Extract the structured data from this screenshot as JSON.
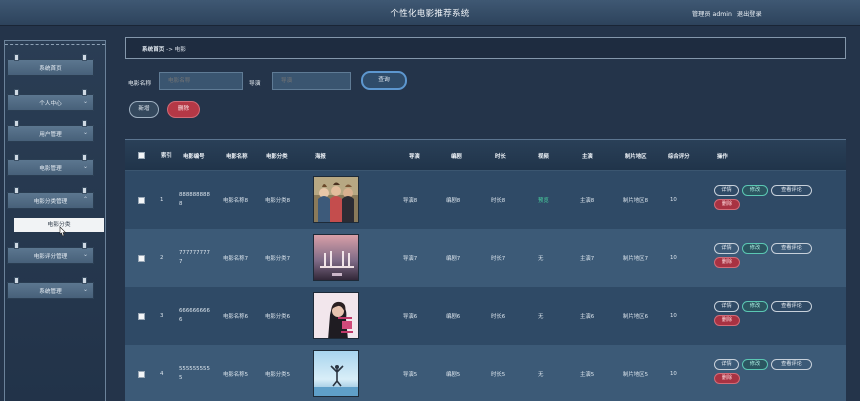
{
  "header": {
    "title": "个性化电影推荐系统",
    "user_label": "管理员 admin",
    "logout_label": "退出登录"
  },
  "sidebar": {
    "items": [
      {
        "label": "系统首页",
        "has_chevron": false
      },
      {
        "label": "个人中心",
        "has_chevron": true
      },
      {
        "label": "用户管理",
        "has_chevron": true
      },
      {
        "label": "电影管理",
        "has_chevron": true
      },
      {
        "label": "电影分类管理",
        "has_chevron": true,
        "expanded": true
      },
      {
        "label": "电影评分管理",
        "has_chevron": true
      },
      {
        "label": "系统管理",
        "has_chevron": true
      }
    ],
    "chevron_down": "⌄",
    "chevron_up": "⌃",
    "sub_item": "电影分类"
  },
  "breadcrumb": {
    "home": "系统首页",
    "separator": "->",
    "current": "电影"
  },
  "search": {
    "name_label": "电影名称",
    "name_placeholder": "电影名称",
    "director_label": "导演",
    "director_placeholder": "导演",
    "query_label": "查询"
  },
  "actions": {
    "add_label": "新增",
    "delete_label": "删除"
  },
  "table": {
    "columns": [
      "索引",
      "电影编号",
      "电影名称",
      "电影分类",
      "海报",
      "导演",
      "编剧",
      "时长",
      "视频",
      "主演",
      "制片地区",
      "综合评分",
      "操作"
    ],
    "row_buttons": {
      "detail": "详情",
      "edit": "修改",
      "review": "查看评论",
      "remove": "删除"
    },
    "rows": [
      {
        "index": "1",
        "code": "888888888\n8",
        "name": "电影名称8",
        "category": "电影分类8",
        "director": "导演8",
        "writer": "编剧8",
        "duration": "时长8",
        "video": "预览",
        "actor": "主演8",
        "region": "制片地区8",
        "score": "10"
      },
      {
        "index": "2",
        "code": "777777777\n7",
        "name": "电影名称7",
        "category": "电影分类7",
        "director": "导演7",
        "writer": "编剧7",
        "duration": "时长7",
        "video": "无",
        "actor": "主演7",
        "region": "制片地区7",
        "score": "10"
      },
      {
        "index": "3",
        "code": "666666666\n6",
        "name": "电影名称6",
        "category": "电影分类6",
        "director": "导演6",
        "writer": "编剧6",
        "duration": "时长6",
        "video": "无",
        "actor": "主演6",
        "region": "制片地区6",
        "score": "10"
      },
      {
        "index": "4",
        "code": "555555555\n5",
        "name": "电影名称5",
        "category": "电影分类5",
        "director": "导演5",
        "writer": "编剧5",
        "duration": "时长5",
        "video": "无",
        "actor": "主演5",
        "region": "制片地区5",
        "score": "10"
      }
    ]
  },
  "colors": {
    "background": "#24344a",
    "accent": "#5d97cf",
    "danger": "#b53846",
    "success": "#49d6a0"
  }
}
